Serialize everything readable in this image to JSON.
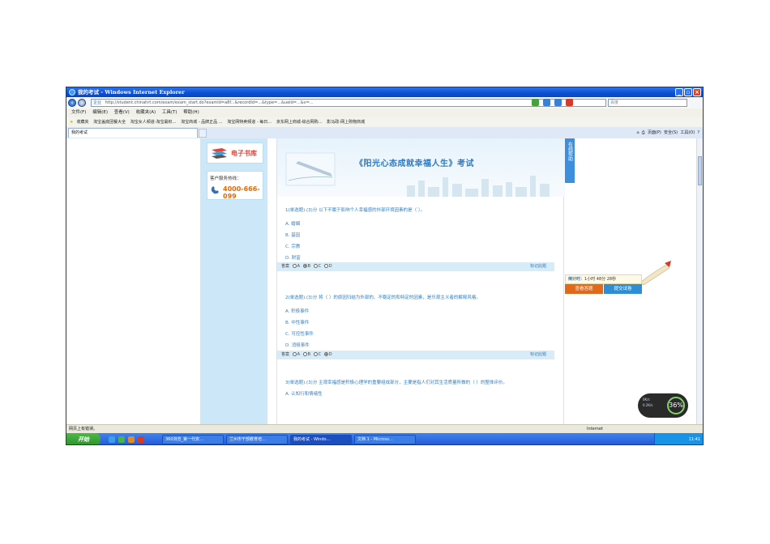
{
  "window": {
    "title": "我的考试 - Windows Internet Explorer"
  },
  "nav": {
    "address_prefix": "企业",
    "url": "http://student.chinahrt.com/exam/exam_start.do?examId=a8f...&recordId=...&type=...&ueId=...&v=...",
    "search_placeholder": "百度"
  },
  "menu": [
    "文件(F)",
    "编辑(E)",
    "查看(V)",
    "收藏夹(A)",
    "工具(T)",
    "帮助(H)"
  ],
  "favorites": {
    "label": "收藏夹",
    "items": [
      "淘宝盖底团餐大全",
      "淘宝女人频道-淘宝最织…",
      "淘宝商城 - 品牌正品 …",
      "淘宝网特卖频道 - 每日…",
      "京东网上商城-综合网购…",
      "影马政-网上购物商城"
    ]
  },
  "tab": {
    "label": "我的考试"
  },
  "commandbar": {
    "page": "页面(P)",
    "safety": "安全(S)",
    "tools": "工具(O)"
  },
  "left": {
    "ebook": "电子书库",
    "service_title": "客户服务热线：",
    "phone": "4000-666-099"
  },
  "exam": {
    "title": "《阳光心态成就幸福人生》考试",
    "questions": [
      {
        "text": "1(单选题).(3)分 以下不属于影响个人幸福感的外部环境因素的是（ ）。",
        "options": [
          "A. 婚姻",
          "B. 基因",
          "C. 宗教",
          "D. 财富"
        ],
        "answer_label": "答案",
        "answer_opts": [
          "A",
          "B",
          "C",
          "D"
        ],
        "selected": 1,
        "mark": "标记此题"
      },
      {
        "text": "2(单选题).(3)分 将（ ）的原因归结为外部的、不稳定的和特定的因素，是乐观主义者的解释风格。",
        "options": [
          "A. 积极事件",
          "B. 中性事件",
          "C. 可控性事件",
          "D. 消极事件"
        ],
        "answer_label": "答案",
        "answer_opts": [
          "A",
          "B",
          "C",
          "D"
        ],
        "selected": 3,
        "mark": "标记此题"
      },
      {
        "text": "3(单选题).(3)分 主观幸福感是积极心理学的重要组成部分，主要是指人们对其生活质量所做的（ ）的整体评价。",
        "options": [
          "A. 认知行和情绪性"
        ]
      }
    ]
  },
  "sidebar_right": {
    "help": "在线帮助",
    "timer_label": "倒计时：",
    "timer_value": "1小时 48分 28秒",
    "view_answers": "查看答题",
    "submit": "提交试卷"
  },
  "network_widget": {
    "up": "0K/s",
    "down": "0.2K/s",
    "percent": "36%"
  },
  "status": {
    "text": "网页上有错误。",
    "zone": "Internet"
  },
  "taskbar": {
    "start": "开始",
    "buttons": [
      "360浏览_第一代安…",
      "兰州市干部教育培…",
      "我的考试 - Windo…",
      "文档 1 - Microso…"
    ],
    "clock": "11:41"
  }
}
